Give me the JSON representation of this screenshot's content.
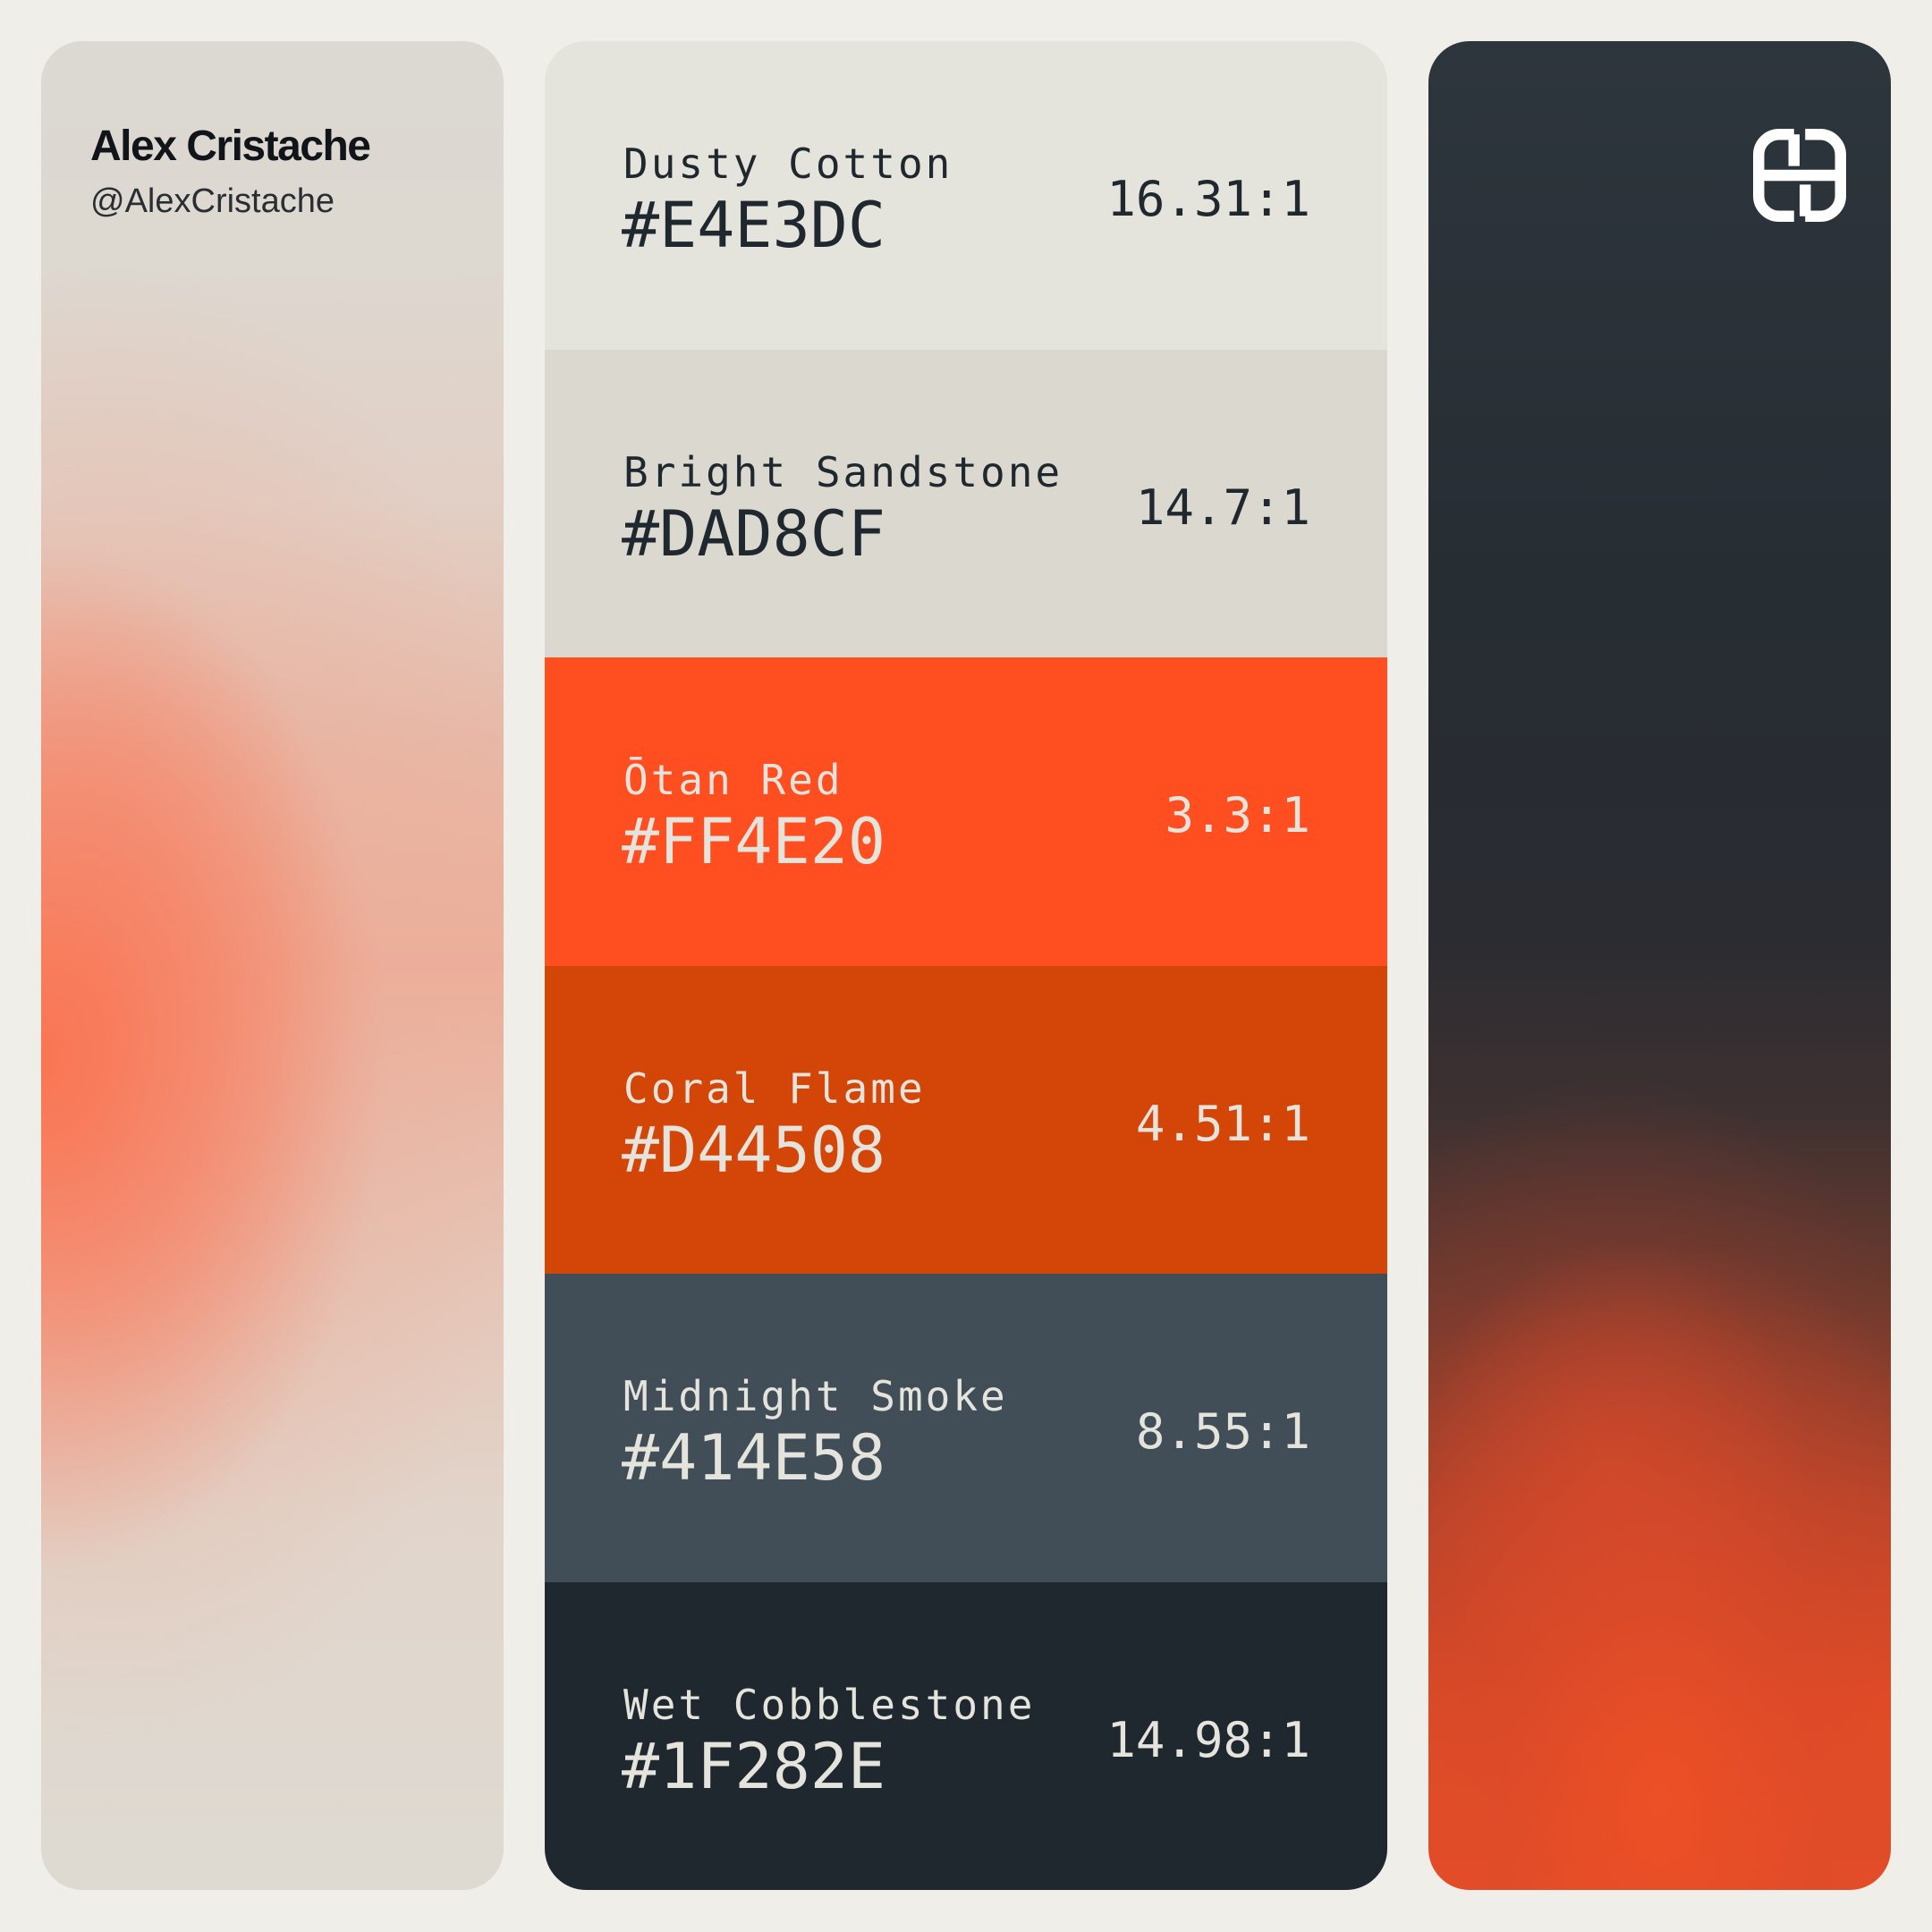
{
  "author": {
    "name": "Alex Cristache",
    "handle": "@AlexCristache"
  },
  "logo_icon": "interlocking-loops-logo-icon",
  "palette": [
    {
      "name": "Dusty Cotton",
      "hex": "#E4E3DC",
      "ratio": "16.31:1",
      "text_color": "#1F282E"
    },
    {
      "name": "Bright Sandstone",
      "hex": "#DAD8CF",
      "ratio": "14.7:1",
      "text_color": "#1F282E"
    },
    {
      "name": "Ōtan Red",
      "hex": "#FF4E20",
      "ratio": "3.3:1",
      "text_color": "#E4E3DC"
    },
    {
      "name": "Coral Flame",
      "hex": "#D44508",
      "ratio": "4.51:1",
      "text_color": "#E4E3DC"
    },
    {
      "name": "Midnight Smoke",
      "hex": "#414E58",
      "ratio": "8.55:1",
      "text_color": "#E4E3DC"
    },
    {
      "name": "Wet Cobblestone",
      "hex": "#1F282E",
      "ratio": "14.98:1",
      "text_color": "#E4E3DC"
    }
  ]
}
